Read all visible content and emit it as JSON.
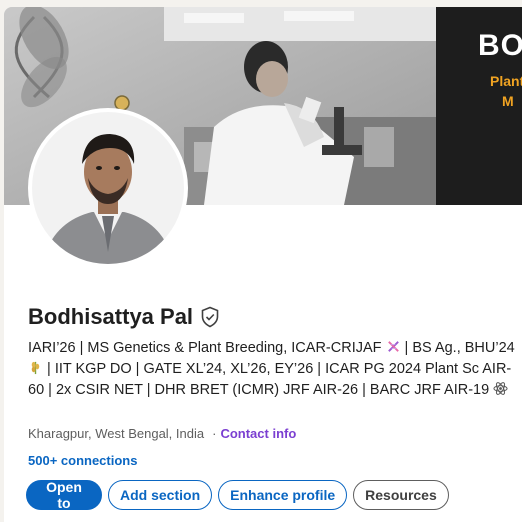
{
  "profile": {
    "name": "Bodhisattya Pal",
    "verified_icon": "verified-shield-icon",
    "headline_part1": "IARI’26 | MS Genetics & Plant Breeding, ICAR-CRIJAF ",
    "headline_part2": " | BS Ag., BHU’24 ",
    "headline_part3": " | IIT KGP DO | GATE XL’24, XL’26, EY’26 | ICAR PG 2024 Plant Sc AIR-60 | 2x CSIR NET | DHR BRET (ICMR) JRF AIR-26 | BARC JRF AIR-19 ",
    "emoji_icons": [
      "dna-icon",
      "wheat-icon",
      "atom-icon"
    ],
    "location": "Kharagpur, West Bengal, India",
    "separator": "·",
    "contact_label": "Contact info",
    "connections": "500+ connections"
  },
  "cover": {
    "title": "BO",
    "line1": "Plant",
    "line2": "M"
  },
  "actions": {
    "open_to": "Open to",
    "add_section": "Add section",
    "enhance_profile": "Enhance profile",
    "resources": "Resources"
  },
  "colors": {
    "primary": "#0a66c2",
    "contact": "#7b3fd1",
    "cover_accent": "#f0a322"
  }
}
